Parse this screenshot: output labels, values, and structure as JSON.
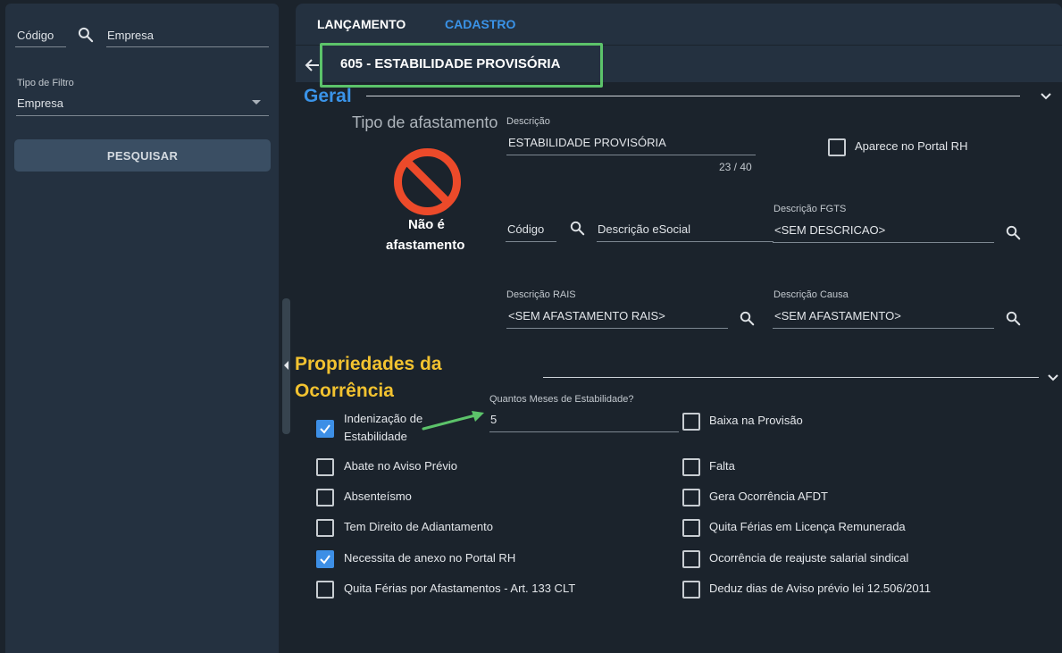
{
  "sidebar": {
    "codigo_label": "Código",
    "empresa_label": "Empresa",
    "tipo_filtro_label": "Tipo de Filtro",
    "tipo_filtro_value": "Empresa",
    "pesquisar_button": "PESQUISAR"
  },
  "header": {
    "tabs": [
      {
        "label": "LANÇAMENTO",
        "color": "#ffffff"
      },
      {
        "label": "CADASTRO",
        "color": "#3a93e8"
      }
    ],
    "title": "605 - ESTABILIDADE PROVISÓRIA"
  },
  "geral": {
    "section_title": "Geral",
    "tipo_afastamento_label": "Tipo de afastamento",
    "afastamento_status_line1": "Não é",
    "afastamento_status_line2": "afastamento",
    "descricao_label": "Descrição",
    "descricao_value": "ESTABILIDADE PROVISÓRIA",
    "descricao_counter": "23 / 40",
    "portal_rh_label": "Aparece no Portal RH",
    "codigo_label": "Código",
    "descricao_esocial_label": "Descrição eSocial",
    "descricao_fgts_label": "Descrição FGTS",
    "descricao_fgts_value": "<SEM DESCRICAO>",
    "descricao_rais_label": "Descrição RAIS",
    "descricao_rais_value": "<SEM AFASTAMENTO RAIS>",
    "descricao_causa_label": "Descrição Causa",
    "descricao_causa_value": "<SEM AFASTAMENTO>"
  },
  "propriedades": {
    "section_title_line1": "Propriedades da",
    "section_title_line2": "Ocorrência",
    "meses_label": "Quantos Meses de Estabilidade?",
    "meses_value": "5",
    "indenizacao_line1": "Indenização de",
    "indenizacao_line2": "Estabilidade",
    "left_options": [
      {
        "label": "Abate no Aviso Prévio",
        "checked": false
      },
      {
        "label": "Absenteísmo",
        "checked": false
      },
      {
        "label": "Tem Direito de Adiantamento",
        "checked": false
      },
      {
        "label": "Necessita de anexo no Portal RH",
        "checked": true
      },
      {
        "label": "Quita Férias por Afastamentos - Art. 133 CLT",
        "checked": false
      }
    ],
    "right_options": [
      {
        "label": "Baixa na Provisão",
        "checked": false
      },
      {
        "label": "Falta",
        "checked": false
      },
      {
        "label": "Gera Ocorrência AFDT",
        "checked": false
      },
      {
        "label": "Quita Férias em Licença Remunerada",
        "checked": false
      },
      {
        "label": "Ocorrência de reajuste salarial sindical",
        "checked": false
      },
      {
        "label": "Deduz dias de Aviso prévio lei 12.506/2011",
        "checked": false
      }
    ]
  },
  "colors": {
    "geral_title": "#3a93e8",
    "propriedades_title": "#f2c230",
    "highlight_box": "#5cc36a",
    "checkbox_checked": "#3d8fe6",
    "block_icon": "#ec4a2a"
  }
}
